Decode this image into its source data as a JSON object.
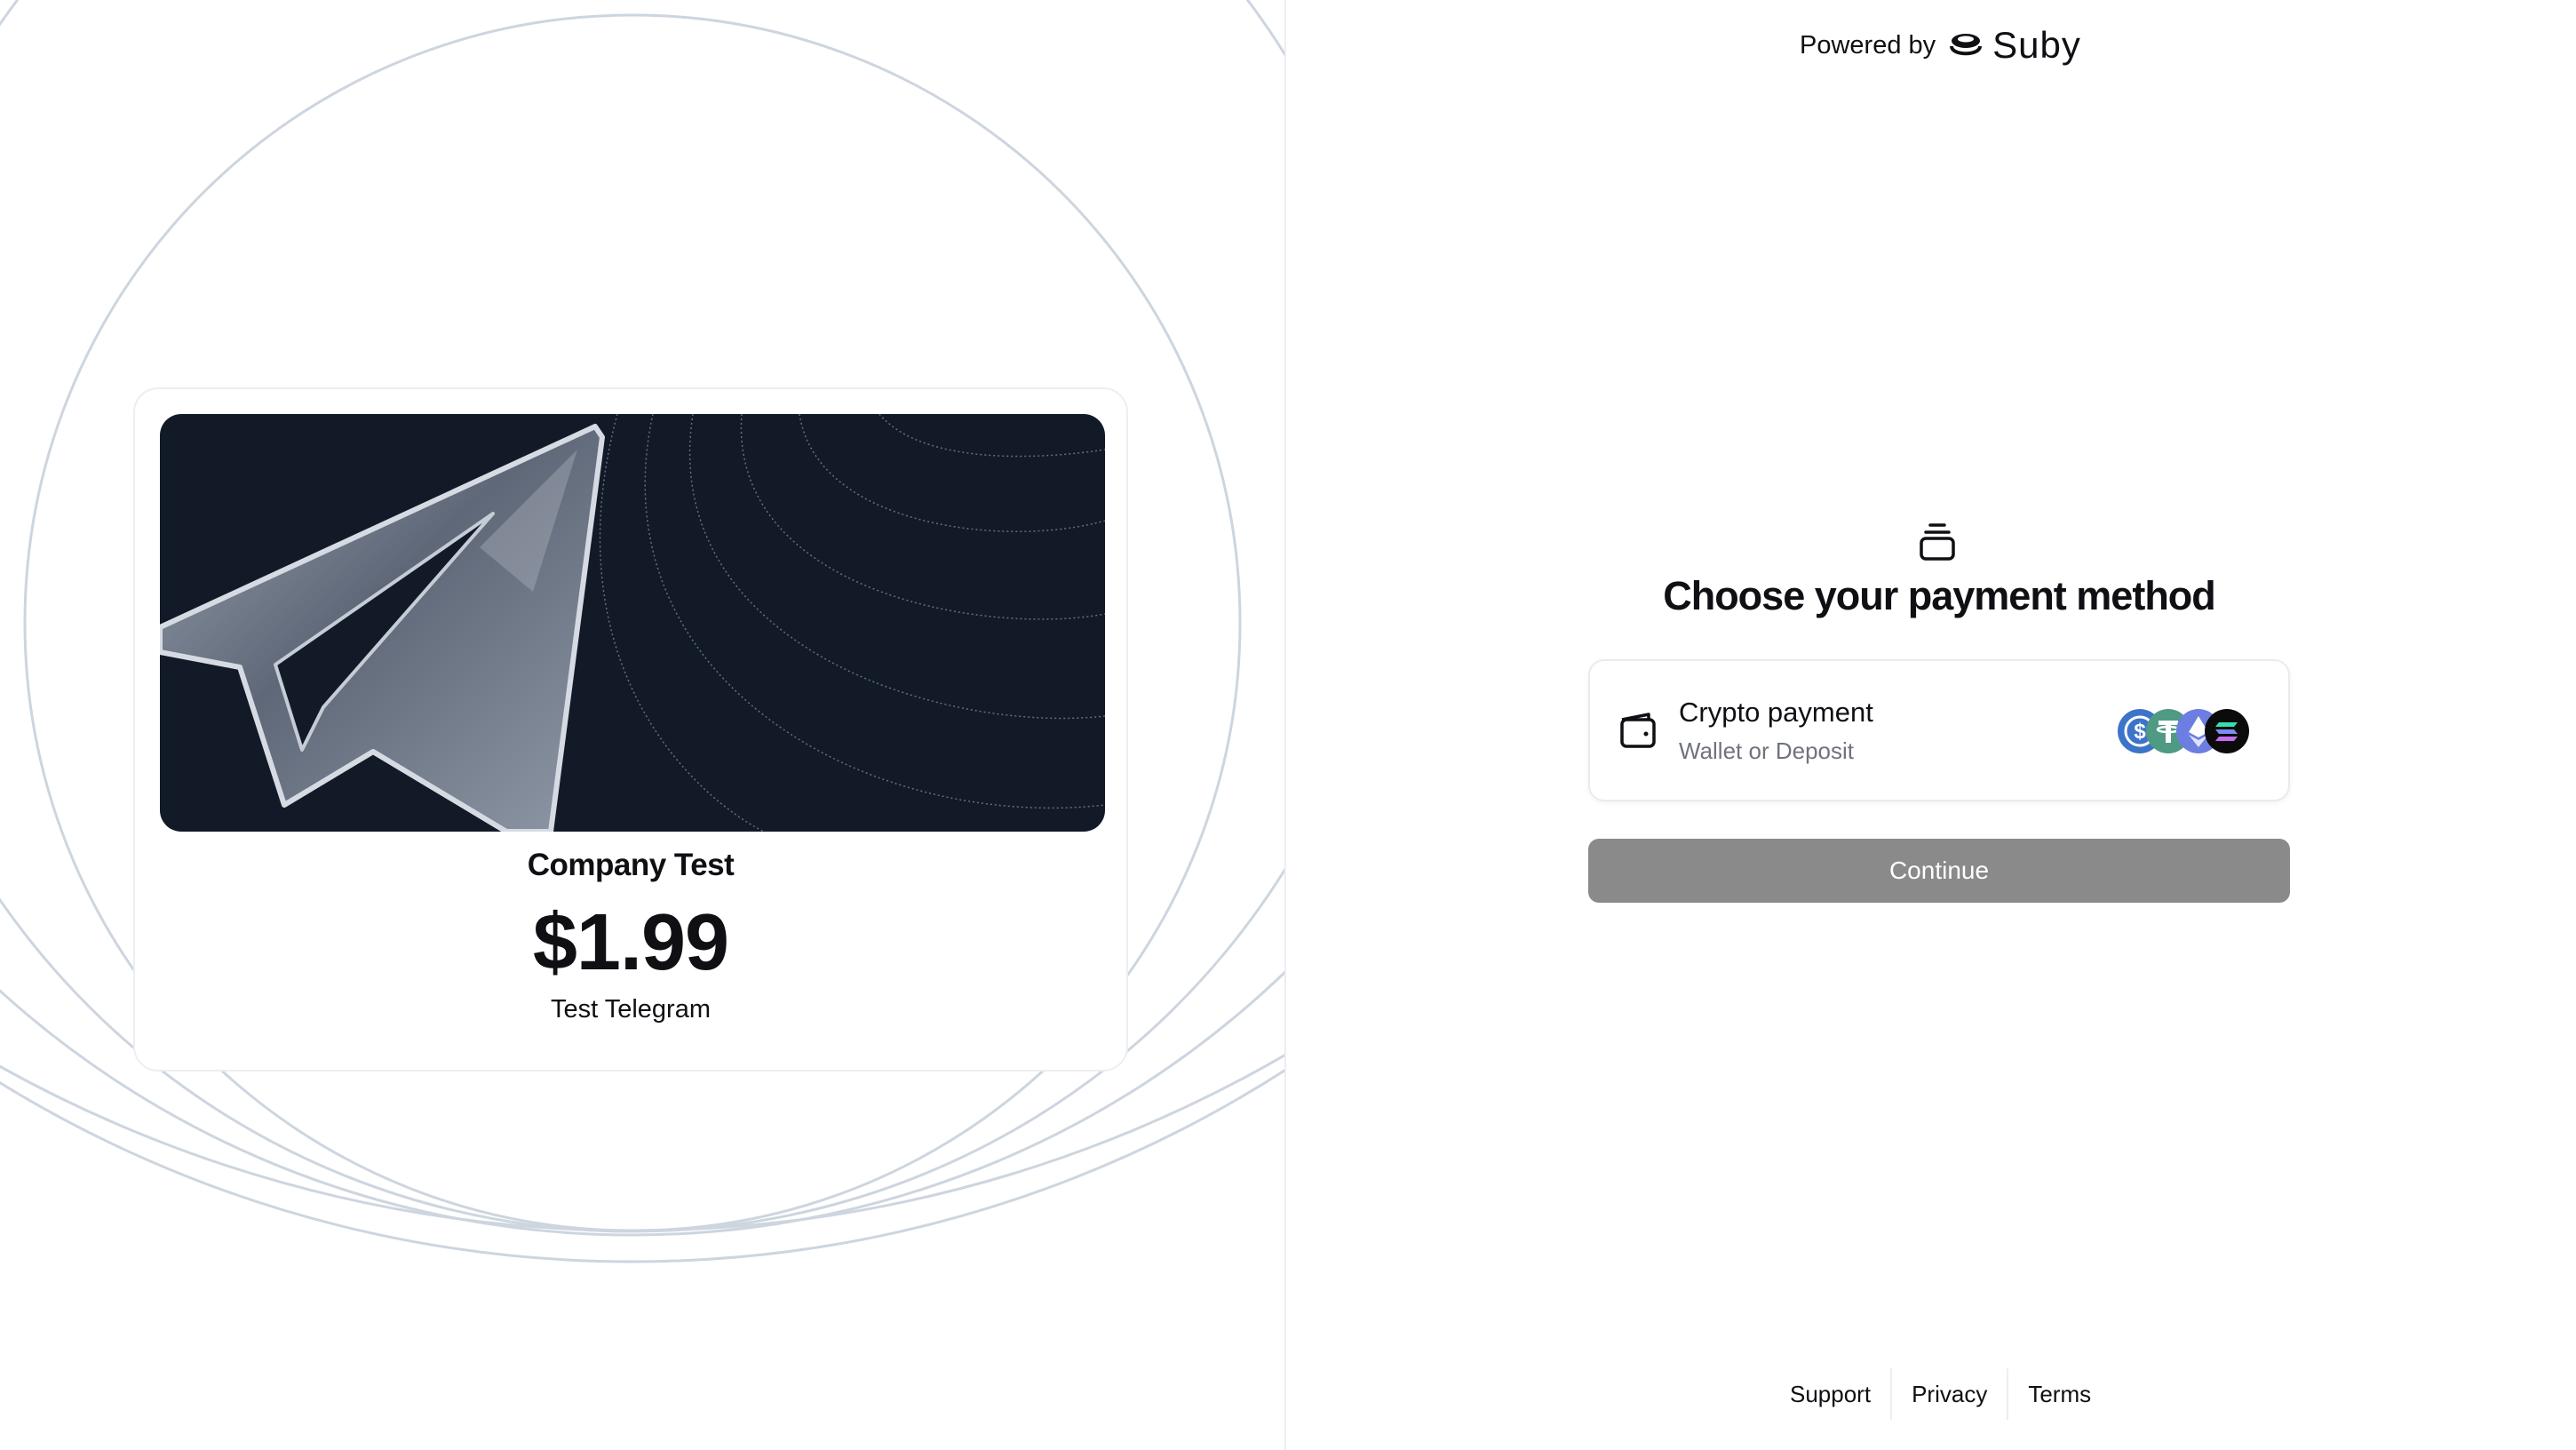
{
  "colors": {
    "background": "#ffffff",
    "text_primary": "#0f0f14",
    "text_secondary": "#6f737b",
    "card_border": "#eceef2",
    "ring_stroke": "#cdd5df",
    "banner_background": "#121a27",
    "button_disabled": "#8a8a8a"
  },
  "header": {
    "powered_by_label": "Powered by",
    "brand_name": "Suby",
    "brand_icon": "suby-logo-icon"
  },
  "product": {
    "company_name": "Company Test",
    "price": "$1.99",
    "name": "Test Telegram",
    "banner_icon": "telegram-paper-plane"
  },
  "payment": {
    "icon": "stacked-cards-icon",
    "title": "Choose your payment method",
    "methods": [
      {
        "title": "Crypto payment",
        "subtitle": "Wallet or Deposit",
        "icon": "wallet-icon",
        "coins": [
          {
            "name": "usdc-icon",
            "color": "#3d74c9"
          },
          {
            "name": "usdt-icon",
            "color": "#4f9a83"
          },
          {
            "name": "ethereum-icon",
            "color": "#6c7ee1"
          },
          {
            "name": "solana-icon",
            "color": "#0b0b0b"
          }
        ]
      }
    ],
    "continue_label": "Continue",
    "continue_enabled": false
  },
  "footer": {
    "links": [
      "Support",
      "Privacy",
      "Terms"
    ]
  }
}
